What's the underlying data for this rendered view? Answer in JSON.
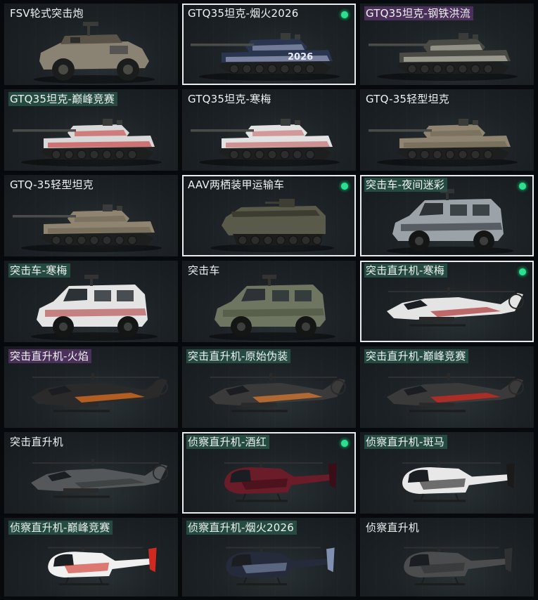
{
  "cards": [
    {
      "label": "FSV轮式突击炮",
      "tag": "none",
      "selected": false,
      "badge": false,
      "vehicle": "wheeled-assault-gun",
      "icon": "fsv-vehicle-icon",
      "color": "#8a8272",
      "accent": "#5a5448"
    },
    {
      "label": "GTQ35坦克-烟火2026",
      "tag": "none",
      "selected": true,
      "badge": true,
      "vehicle": "tank",
      "icon": "gtq35-tank-fireworks-icon",
      "color": "#2a3550",
      "accent": "#b9c3e0",
      "decal": "2026"
    },
    {
      "label": "GTQ35坦克-钢铁洪流",
      "tag": "purple",
      "selected": false,
      "badge": false,
      "vehicle": "tank",
      "icon": "gtq35-tank-steel-torrent-icon",
      "color": "#4a4a44",
      "accent": "#d9d9c8"
    },
    {
      "label": "GTQ35坦克-巅峰竞赛",
      "tag": "green",
      "selected": false,
      "badge": false,
      "vehicle": "tank",
      "icon": "gtq35-tank-peak-race-icon",
      "color": "#d8d8d8",
      "accent": "#c42020"
    },
    {
      "label": "GTQ35坦克-寒梅",
      "tag": "none",
      "selected": false,
      "badge": false,
      "vehicle": "tank",
      "icon": "gtq35-tank-winter-plum-icon",
      "color": "#e2e2e2",
      "accent": "#c05050"
    },
    {
      "label": "GTQ-35轻型坦克",
      "tag": "none",
      "selected": false,
      "badge": false,
      "vehicle": "tank",
      "icon": "gtq35-light-tank-icon",
      "color": "#8f8470",
      "accent": "#6a6050"
    },
    {
      "label": "GTQ-35轻型坦克",
      "tag": "none",
      "selected": false,
      "badge": false,
      "vehicle": "tank",
      "icon": "gtq35-light-tank-icon",
      "color": "#8f8470",
      "accent": "#6a6050"
    },
    {
      "label": "AAV两栖装甲运输车",
      "tag": "none",
      "selected": true,
      "badge": true,
      "vehicle": "amphibious",
      "icon": "aav-amphibious-vehicle-icon",
      "color": "#5a5a4a",
      "accent": "#3c3c30"
    },
    {
      "label": "突击车-夜间迷彩",
      "tag": "green",
      "selected": true,
      "badge": true,
      "vehicle": "armored-car",
      "icon": "assault-vehicle-night-camo-icon",
      "color": "#9ba3a8",
      "accent": "#2a2e33"
    },
    {
      "label": "突击车-寒梅",
      "tag": "green",
      "selected": false,
      "badge": false,
      "vehicle": "armored-car",
      "icon": "assault-vehicle-winter-plum-icon",
      "color": "#e4e4e4",
      "accent": "#b04040"
    },
    {
      "label": "突击车",
      "tag": "none",
      "selected": false,
      "badge": false,
      "vehicle": "armored-car",
      "icon": "assault-vehicle-icon",
      "color": "#6e7560",
      "accent": "#4a503e"
    },
    {
      "label": "突击直升机-寒梅",
      "tag": "green",
      "selected": true,
      "badge": true,
      "vehicle": "attack-heli",
      "icon": "attack-helicopter-winter-plum-icon",
      "color": "#e4e4e4",
      "accent": "#b04040"
    },
    {
      "label": "突击直升机-火焰",
      "tag": "purple",
      "selected": false,
      "badge": false,
      "vehicle": "attack-heli",
      "icon": "attack-helicopter-flame-icon",
      "color": "#2a2a2a",
      "accent": "#e07020"
    },
    {
      "label": "突击直升机-原始伪装",
      "tag": "green",
      "selected": false,
      "badge": false,
      "vehicle": "attack-heli",
      "icon": "attack-helicopter-original-camo-icon",
      "color": "#3a3a3a",
      "accent": "#d87a30"
    },
    {
      "label": "突击直升机-巅峰竞赛",
      "tag": "green",
      "selected": false,
      "badge": false,
      "vehicle": "attack-heli",
      "icon": "attack-helicopter-peak-race-icon",
      "color": "#3a3a3a",
      "accent": "#d02a20"
    },
    {
      "label": "突击直升机",
      "tag": "none",
      "selected": false,
      "badge": false,
      "vehicle": "attack-heli",
      "icon": "attack-helicopter-icon",
      "color": "#55585a",
      "accent": "#3a3c3e"
    },
    {
      "label": "侦察直升机-酒红",
      "tag": "green",
      "selected": true,
      "badge": true,
      "vehicle": "scout-heli",
      "icon": "scout-helicopter-wine-red-icon",
      "color": "#6a1c28",
      "accent": "#3a0e16"
    },
    {
      "label": "侦察直升机-斑马",
      "tag": "green",
      "selected": false,
      "badge": false,
      "vehicle": "scout-heli",
      "icon": "scout-helicopter-zebra-icon",
      "color": "#e8e8e8",
      "accent": "#1a1a1a"
    },
    {
      "label": "侦察直升机-巅峰竞赛",
      "tag": "green",
      "selected": false,
      "badge": false,
      "vehicle": "scout-heli",
      "icon": "scout-helicopter-peak-race-icon",
      "color": "#f0f0f0",
      "accent": "#d02a20"
    },
    {
      "label": "侦察直升机-烟火2026",
      "tag": "green",
      "selected": false,
      "badge": false,
      "vehicle": "scout-heli",
      "icon": "scout-helicopter-fireworks-icon",
      "color": "#252b3a",
      "accent": "#8090b0"
    },
    {
      "label": "侦察直升机",
      "tag": "none",
      "selected": false,
      "badge": false,
      "vehicle": "scout-heli",
      "icon": "scout-helicopter-icon",
      "color": "#4a4c4e",
      "accent": "#2e3032"
    }
  ]
}
